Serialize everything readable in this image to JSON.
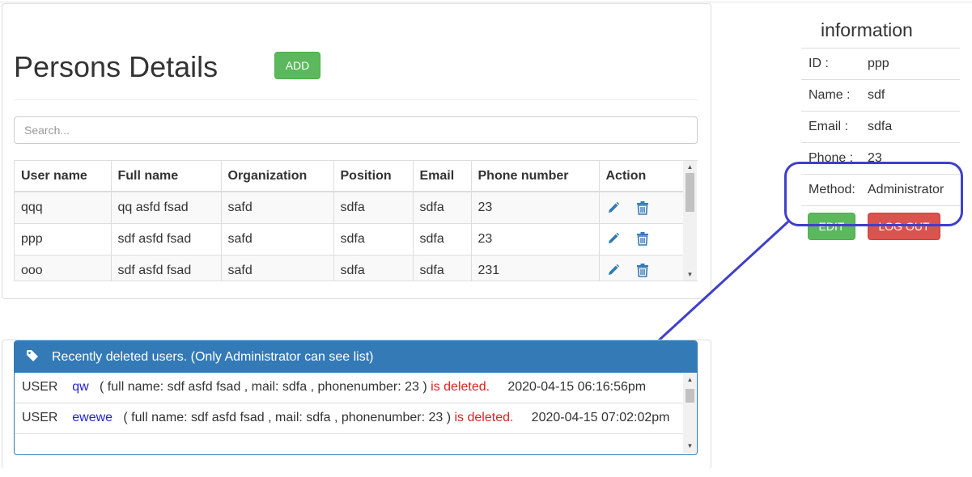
{
  "persons": {
    "title": "Persons Details",
    "add_label": "ADD",
    "search_placeholder": "Search...",
    "columns": [
      "User name",
      "Full name",
      "Organization",
      "Position",
      "Email",
      "Phone number",
      "Action"
    ],
    "rows": [
      [
        "qqq",
        "qq asfd fsad",
        "safd",
        "sdfa",
        "sdfa",
        "23"
      ],
      [
        "ppp",
        "sdf asfd fsad",
        "safd",
        "sdfa",
        "sdfa",
        "23"
      ],
      [
        "ooo",
        "sdf asfd fsad",
        "safd",
        "sdfa",
        "sdfa",
        "231"
      ]
    ],
    "action_icons": [
      "pencil-icon",
      "trash-icon"
    ]
  },
  "info": {
    "title": "information",
    "rows": [
      {
        "label": "ID  :",
        "value": "ppp"
      },
      {
        "label": "Name  :",
        "value": "sdf"
      },
      {
        "label": "Email  :",
        "value": "sdfa"
      },
      {
        "label": "Phone :",
        "value": "23"
      },
      {
        "label": "Method:",
        "value": "Administrator"
      }
    ],
    "edit_label": "EDIT",
    "logout_label": "LOG OUT"
  },
  "deleted": {
    "header": "Recently deleted users. (Only Administrator can see list)",
    "header_icon": "tag-icon",
    "items": [
      {
        "prefix": "USER",
        "user": "qw",
        "details": "( full name: sdf  asfd  fsad  , mail: sdfa  , phonenumber: 23  )",
        "status": "is deleted.",
        "time": "2020-04-15 06:16:56pm"
      },
      {
        "prefix": "USER",
        "user": "ewewe",
        "details": "( full name: sdf  asfd  fsad  , mail: sdfa  , phonenumber: 23  )",
        "status": "is deleted.",
        "time": "2020-04-15 07:02:02pm"
      }
    ]
  },
  "colors": {
    "success": "#5cb85c",
    "danger": "#d9534f",
    "primary": "#337ab7",
    "annotation": "#3f3fcc",
    "deleted_text": "#dd2222",
    "username_link": "#2222cc"
  }
}
